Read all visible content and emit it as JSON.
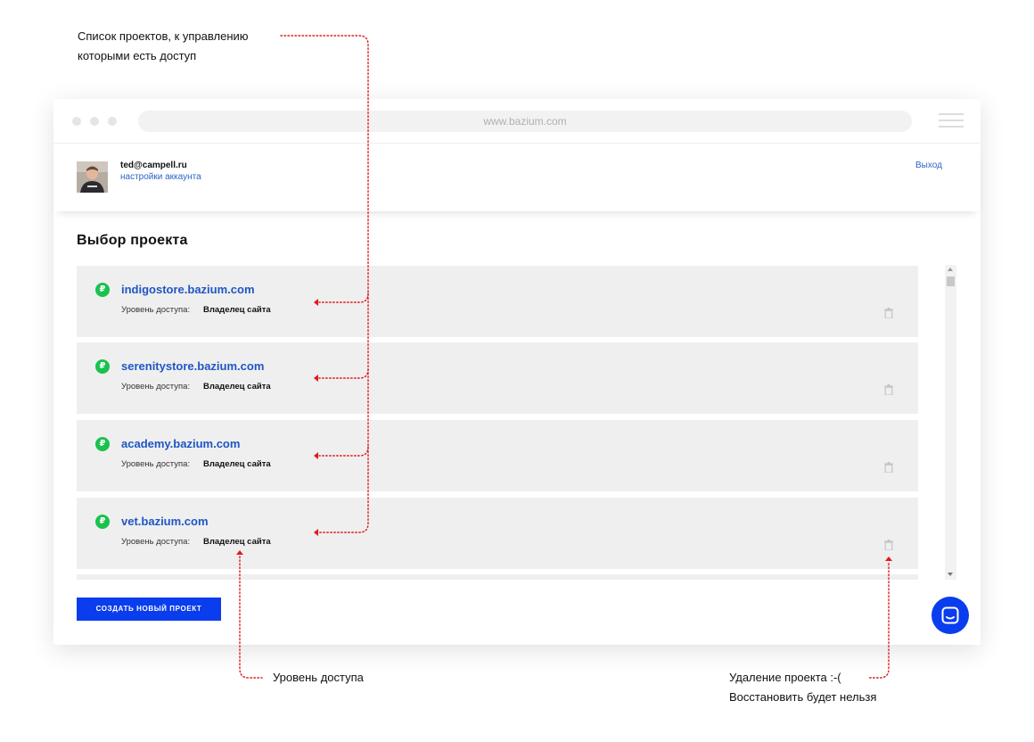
{
  "annotations": {
    "projects_list_line1": "Список проектов, к управлению",
    "projects_list_line2": "которыми есть доступ",
    "access_level": "Уровень доступа",
    "delete_line1": "Удаление проекта :-(",
    "delete_line2": "Восстановить будет нельзя"
  },
  "browser": {
    "url": "www.bazium.com"
  },
  "account": {
    "email": "ted@campell.ru",
    "settings_label": "настройки аккаунта",
    "logout_label": "Выход"
  },
  "page": {
    "title": "Выбор проекта",
    "create_button_label": "Создать новый проект"
  },
  "projects": [
    {
      "name": "indigostore.bazium.com",
      "access_label": "Уровень доступа:",
      "access_value": "Владелец сайта",
      "icon": "ruble-icon"
    },
    {
      "name": "serenitystore.bazium.com",
      "access_label": "Уровень доступа:",
      "access_value": "Владелец сайта",
      "icon": "ruble-icon"
    },
    {
      "name": "academy.bazium.com",
      "access_label": "Уровень доступа:",
      "access_value": "Владелец сайта",
      "icon": "ruble-icon"
    },
    {
      "name": "vet.bazium.com",
      "access_label": "Уровень доступа:",
      "access_value": "Владелец сайта",
      "icon": "ruble-icon"
    }
  ],
  "colors": {
    "accent": "#0a3ded",
    "link": "#1f56c4",
    "ruble_badge": "#19c24d",
    "annotation_red": "#e0191b",
    "card_bg": "#efefef"
  }
}
